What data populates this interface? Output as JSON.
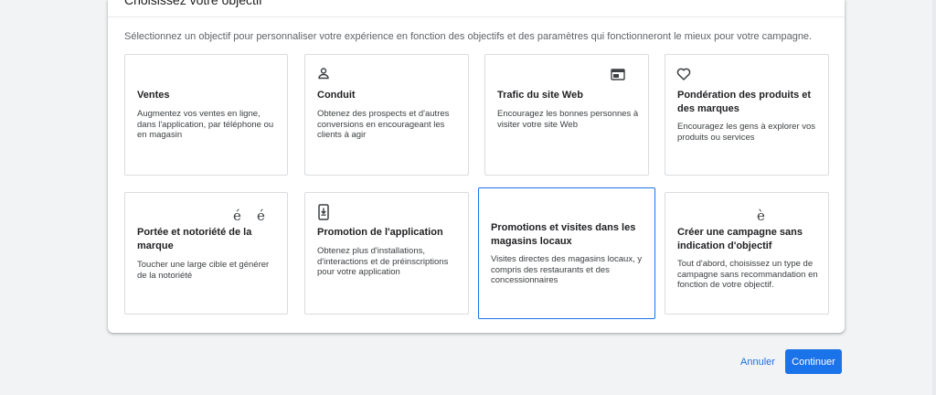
{
  "header": {
    "title": "Choisissez votre objectif",
    "subtitle": "Sélectionnez un objectif pour personnaliser votre expérience en fonction des objectifs et des paramètres qui fonctionneront le mieux pour votre campagne."
  },
  "goals": [
    {
      "icon": "none",
      "title": "Ventes",
      "desc": "Augmentez vos ventes en ligne, dans l'application, par téléphone ou en magasin",
      "selected": false
    },
    {
      "icon": "person-icon",
      "title": "Conduit",
      "desc": "Obtenez des prospects et d'autres conversions en encourageant les clients à agir",
      "selected": false
    },
    {
      "icon": "web-browser-icon",
      "title": "Trafic du site Web",
      "desc": "Encouragez les bonnes personnes à visiter votre site Web",
      "selected": false
    },
    {
      "icon": "heart-icon",
      "title": "Pondération des produits et des marques",
      "desc": "Encouragez les gens à explorer vos produits ou services",
      "selected": false
    },
    {
      "icon": "glyph",
      "glyph1": "é",
      "glyph2": "é",
      "title": "Portée et notoriété de la marque",
      "desc": "Toucher une large cible et générer de la notoriété",
      "selected": false
    },
    {
      "icon": "phone-download-icon",
      "title": "Promotion de l'application",
      "desc": "Obtenez plus d'installations, d'interactions et de préinscriptions pour votre application",
      "selected": false
    },
    {
      "icon": "none",
      "title": "Promotions et visites dans les magasins locaux",
      "desc": "Visites directes des magasins locaux, y compris des restaurants et des concessionnaires",
      "selected": true
    },
    {
      "icon": "glyph",
      "glyph1": "è",
      "title": "Créer une campagne sans indication d'objectif",
      "desc": "Tout d'abord, choisissez un type de campagne sans recommandation en fonction de votre objectif.",
      "selected": false
    }
  ],
  "footer": {
    "cancel_label": "Annuler",
    "continue_label": "Continuer"
  },
  "colors": {
    "accent": "#1a73e8",
    "border": "#dadce0",
    "background": "#f1f3f4"
  }
}
